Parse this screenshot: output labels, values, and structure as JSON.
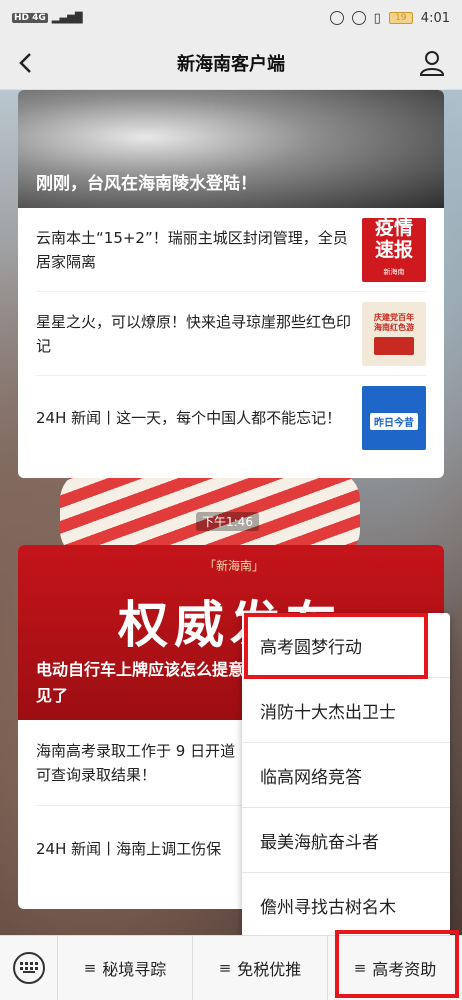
{
  "status_bar": {
    "network": "HD 4G",
    "battery": "19",
    "time": "4:01",
    "icons": [
      "eye-icon",
      "alarm-icon",
      "vibrate-icon",
      "battery-icon"
    ]
  },
  "nav": {
    "title": "新海南客户端",
    "back_icon": "back-arrow-icon",
    "user_icon": "user-icon"
  },
  "card1": {
    "hero_caption": "刚刚，台风在海南陵水登陆！",
    "items": [
      {
        "text": "云南本土“15+2”！瑞丽主城区封闭管理，全员居家隔离",
        "thumb_text": "疫情\n速报",
        "thumb_sub": "新海南"
      },
      {
        "text": "星星之火，可以燎原！快来追寻琼崖那些红色印记",
        "thumb_text": "庆建党百年\n海南红色游"
      },
      {
        "text": "24H 新闻丨这一天，每个中国人都不能忘记！",
        "thumb_text": "昨日今昔"
      }
    ]
  },
  "time_tip": "下午1:46",
  "card2": {
    "brand": "「新海南」",
    "hero_big": "权威发布",
    "hero_caption": "电动自行车上牌应该怎么提意见了",
    "items": [
      {
        "text": "海南高考录取工作于 9 日开道可查询录取结果！"
      },
      {
        "text": "24H 新闻丨海南上调工伤保"
      }
    ]
  },
  "popup_menu": {
    "items": [
      "高考圆梦行动",
      "消防十大杰出卫士",
      "临高网络竞答",
      "最美海航奋斗者",
      "儋州寻找古树名木"
    ]
  },
  "bottom_bar": {
    "keyboard_icon": "keyboard-icon",
    "tabs": [
      "秘境寻踪",
      "免税优推",
      "高考资助"
    ]
  },
  "colors": {
    "highlight": "#e5161c",
    "brand_red": "#c4141a"
  }
}
